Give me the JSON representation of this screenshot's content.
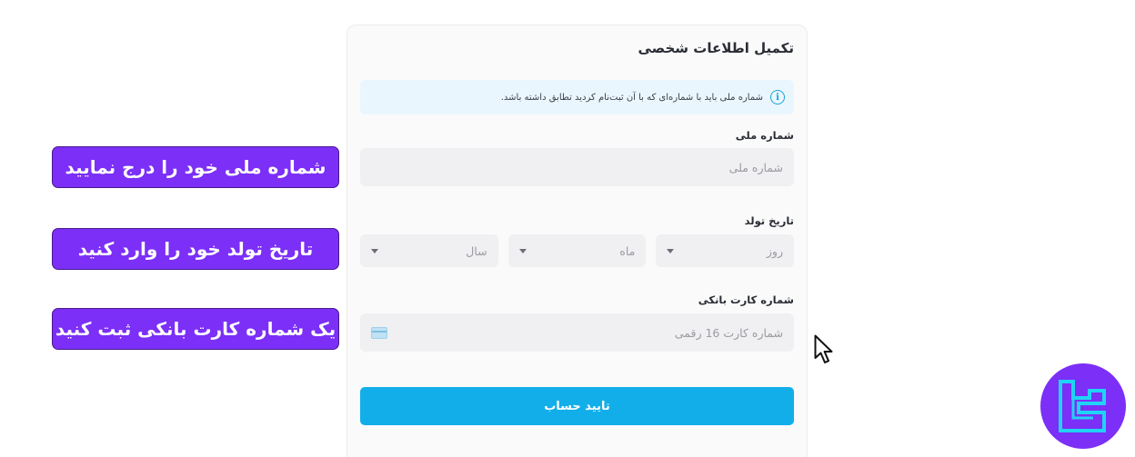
{
  "form": {
    "title": "تکمیل اطلاعات شخصی",
    "notice": "شماره ملی باید با شماره‌ای که با آن ثبت‌نام کردید تطابق داشته باشد.",
    "national_id": {
      "label": "شماره ملی",
      "placeholder": "شماره ملی"
    },
    "birth_date": {
      "label": "تاریخ تولد",
      "day": "روز",
      "month": "ماه",
      "year": "سال"
    },
    "bank_card": {
      "label": "شماره کارت بانکی",
      "placeholder": "شماره کارت 16 رقمی"
    },
    "submit_label": "تایید حساب"
  },
  "instructions": [
    "شماره ملی خود را درج نمایید",
    "تاریخ تولد خود را وارد کنید",
    "یک شماره کارت بانکی ثبت کنید"
  ],
  "colors": {
    "accent": "#12aeea",
    "pill": "#7b2ff7",
    "logo_bg": "#7b2ff7",
    "logo_mark": "#20d3f5"
  },
  "icons": {
    "notice": "info-icon",
    "select_caret": "chevron-down-icon",
    "card": "credit-card-icon",
    "cursor": "mouse-pointer-icon"
  }
}
